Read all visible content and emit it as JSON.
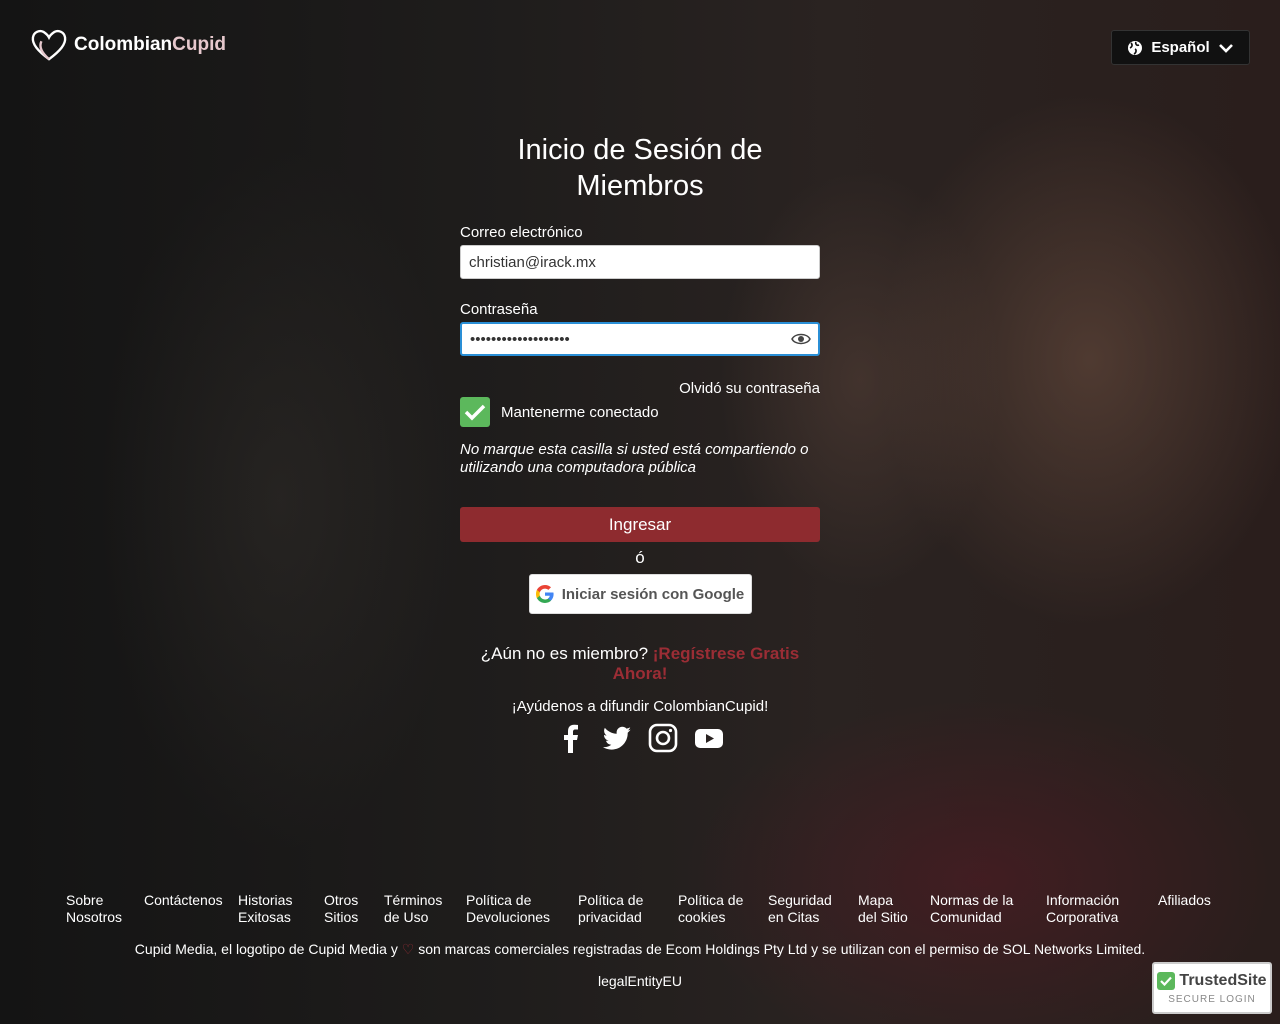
{
  "header": {
    "brand_first": "Colombian",
    "brand_second": "Cupid",
    "language": "Español"
  },
  "login": {
    "title": "Inicio de Sesión de Miembros",
    "email_label": "Correo electrónico",
    "email_value": "christian@irack.mx",
    "password_label": "Contraseña",
    "password_value": "•••••••••••••••••••",
    "forgot": "Olvidó su contraseña",
    "keep_label": "Mantenerme conectado",
    "keep_checked": true,
    "hint": "No marque esta casilla si usted está compartiendo o utilizando una computadora pública",
    "submit": "Ingresar",
    "or": "ó",
    "google": "Iniciar sesión con Google",
    "member_q": "¿Aún no es miembro?",
    "register": "¡Regístrese Gratis Ahora!",
    "spread": "¡Ayúdenos a difundir ColombianCupid!"
  },
  "social": [
    "facebook-icon",
    "twitter-icon",
    "instagram-icon",
    "youtube-icon"
  ],
  "footer": {
    "links": [
      "Sobre Nosotros",
      "Contáctenos",
      "Historias Exitosas",
      "Otros Sitios",
      "Términos de Uso",
      "Política de Devoluciones",
      "Política de privacidad",
      "Política de cookies",
      "Seguridad en Citas",
      "Mapa del Sitio",
      "Normas de la Comunidad",
      "Información Corporativa",
      "Afiliados"
    ],
    "legal_before": "Cupid Media, el logotipo de Cupid Media y",
    "legal_after": "son marcas comerciales registradas de Ecom Holdings Pty Ltd y se utilizan con el permiso de SOL Networks Limited.",
    "entity": "legalEntityEU"
  },
  "trusted": {
    "title": "TrustedSite",
    "subtitle": "SECURE LOGIN"
  },
  "colors": {
    "accent": "#8e2b2f",
    "check": "#5cb85c",
    "focus": "#2a8fd6"
  }
}
